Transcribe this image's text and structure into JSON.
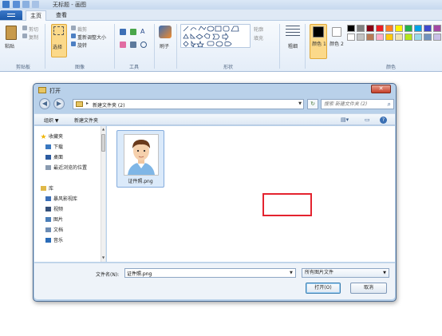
{
  "window": {
    "title": "无标题 - 画图",
    "quick_access": [
      "save-icon",
      "undo-icon",
      "redo-icon"
    ]
  },
  "tabs": [
    {
      "label": "主页",
      "active": true
    },
    {
      "label": "查看",
      "active": false
    }
  ],
  "ribbon": {
    "clipboard": {
      "paste": "粘贴",
      "cut": "剪切",
      "copy": "复制",
      "group": "剪贴板"
    },
    "image": {
      "select": "选择",
      "crop": "裁剪",
      "resize": "重新调整大小",
      "rotate": "旋转",
      "group": "图像"
    },
    "tools": {
      "group": "工具"
    },
    "brushes": {
      "label": "刷子"
    },
    "shapes": {
      "outline": "轮廓",
      "fill": "填充",
      "group": "形状"
    },
    "size": {
      "label": "粗细"
    },
    "colors": {
      "color1": "颜色 1",
      "color2": "颜色 2",
      "group": "颜色",
      "palette": [
        "#000000",
        "#7f7f7f",
        "#880015",
        "#ed1c24",
        "#ff7f27",
        "#fff200",
        "#22b14c",
        "#00a2e8",
        "#3f48cc",
        "#a349a4",
        "#ffffff",
        "#c3c3c3",
        "#b97a57",
        "#ffaec9",
        "#ffc90e",
        "#efe4b0",
        "#b5e61d",
        "#99d9ea",
        "#7092be",
        "#c8bfe7"
      ]
    }
  },
  "dialog": {
    "title": "打开",
    "close": "✕",
    "address": {
      "crumb": "新建文件夹 (2)"
    },
    "search": {
      "placeholder": "搜索 新建文件夹 (2)"
    },
    "toolbar": {
      "organize": "组织 ▼",
      "new_folder": "新建文件夹"
    },
    "nav": [
      {
        "label": "收藏夹",
        "icon": "star-icon",
        "color": "#f0b400"
      },
      {
        "label": "下载",
        "icon": "download-folder-icon",
        "color": "#3a78c0"
      },
      {
        "label": "桌面",
        "icon": "desktop-icon",
        "color": "#2c5ba0"
      },
      {
        "label": "最近浏览的位置",
        "icon": "recent-places-icon",
        "color": "#8a9bb0"
      },
      {
        "label": "库",
        "icon": "library-icon",
        "color": "#e0b848"
      },
      {
        "label": "暴风影视库",
        "icon": "video-library-icon",
        "color": "#3b6fb8"
      },
      {
        "label": "视频",
        "icon": "video-icon",
        "color": "#35507a"
      },
      {
        "label": "图片",
        "icon": "pictures-icon",
        "color": "#4a7db8"
      },
      {
        "label": "文档",
        "icon": "documents-icon",
        "color": "#6c8cb4"
      },
      {
        "label": "音乐",
        "icon": "music-icon",
        "color": "#2b6cb8"
      }
    ],
    "files": [
      {
        "name": "证件照.png"
      }
    ],
    "filename_label": "文件名(N):",
    "filename_value": "证件照.png",
    "filter": "所有图片文件",
    "open_button": "打开(O)",
    "cancel_button": "取消"
  }
}
